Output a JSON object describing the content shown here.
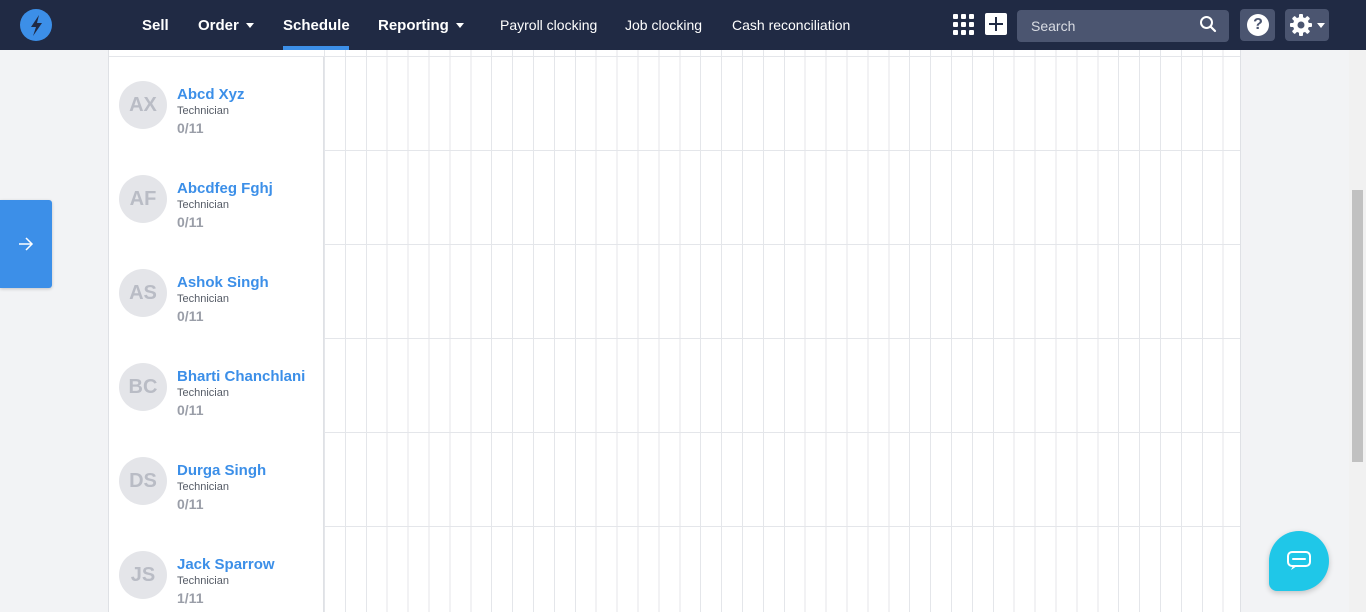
{
  "nav": {
    "sell": "Sell",
    "order": "Order",
    "schedule": "Schedule",
    "reporting": "Reporting",
    "payroll_clocking": "Payroll clocking",
    "job_clocking": "Job clocking",
    "cash_reconciliation": "Cash reconciliation",
    "active_tab": "Schedule"
  },
  "search": {
    "placeholder": "Search"
  },
  "help": {
    "symbol": "?"
  },
  "icons": {
    "logo": "lightning-bolt-icon",
    "apps": "grid-apps-icon",
    "add": "plus-icon",
    "search": "search-icon",
    "help": "help-icon",
    "settings": "gear-icon",
    "side_tab": "arrow-right-icon",
    "chat": "chat-icon"
  },
  "colors": {
    "nav_bg": "#202a44",
    "accent": "#3c8fe8",
    "chat": "#1fc7e8"
  },
  "staff": [
    {
      "initials": "AX",
      "name": "Abcd Xyz",
      "role": "Technician",
      "count": "0/11"
    },
    {
      "initials": "AF",
      "name": "Abcdfeg Fghj",
      "role": "Technician",
      "count": "0/11"
    },
    {
      "initials": "AS",
      "name": "Ashok Singh",
      "role": "Technician",
      "count": "0/11"
    },
    {
      "initials": "BC",
      "name": "Bharti Chanchlani",
      "role": "Technician",
      "count": "0/11"
    },
    {
      "initials": "DS",
      "name": "Durga Singh",
      "role": "Technician",
      "count": "0/11"
    },
    {
      "initials": "JS",
      "name": "Jack Sparrow",
      "role": "Technician",
      "count": "1/11"
    }
  ]
}
